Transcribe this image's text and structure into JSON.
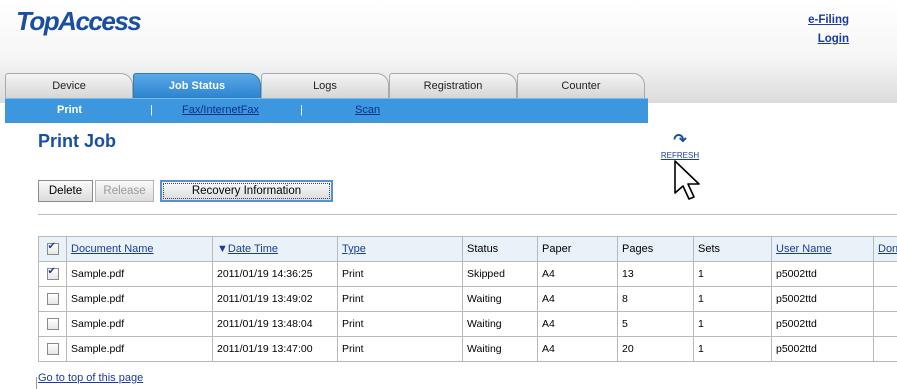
{
  "header": {
    "logo": "TopAccess",
    "efiling_link": "e-Filing",
    "login_link": "Login"
  },
  "tabs": [
    {
      "label": "Device",
      "active": false
    },
    {
      "label": "Job Status",
      "active": true
    },
    {
      "label": "Logs",
      "active": false
    },
    {
      "label": "Registration",
      "active": false
    },
    {
      "label": "Counter",
      "active": false
    }
  ],
  "subnav": {
    "print": "Print",
    "sep1": "|",
    "fax": "Fax/InternetFax",
    "sep2": "|",
    "scan": "Scan"
  },
  "page_title": "Print Job",
  "refresh_label": "REFRESH",
  "buttons": {
    "delete": "Delete",
    "release": "Release",
    "recovery": "Recovery Information"
  },
  "table": {
    "headers": [
      "Document Name",
      "Date Time",
      "Type",
      "Status",
      "Paper",
      "Pages",
      "Sets",
      "User Name",
      "Don"
    ],
    "sort_indicator": "▼",
    "rows": [
      {
        "checked": true,
        "document": "Sample.pdf",
        "datetime": "2011/01/19 14:36:25",
        "type": "Print",
        "status": "Skipped",
        "paper": "A4",
        "pages": "13",
        "sets": "1",
        "user": "p5002ttd",
        "done": ""
      },
      {
        "checked": false,
        "document": "Sample.pdf",
        "datetime": "2011/01/19 13:49:02",
        "type": "Print",
        "status": "Waiting",
        "paper": "A4",
        "pages": "8",
        "sets": "1",
        "user": "p5002ttd",
        "done": ""
      },
      {
        "checked": false,
        "document": "Sample.pdf",
        "datetime": "2011/01/19 13:48:04",
        "type": "Print",
        "status": "Waiting",
        "paper": "A4",
        "pages": "5",
        "sets": "1",
        "user": "p5002ttd",
        "done": ""
      },
      {
        "checked": false,
        "document": "Sample.pdf",
        "datetime": "2011/01/19 13:47:00",
        "type": "Print",
        "status": "Waiting",
        "paper": "A4",
        "pages": "20",
        "sets": "1",
        "user": "p5002ttd",
        "done": ""
      }
    ]
  },
  "footer_link": "Go to top of this page",
  "colors": {
    "brand_blue": "#1a4fa0",
    "tab_active": "#2b83cf",
    "subnav_bg": "#3d97de",
    "link": "#1a3c9e"
  }
}
